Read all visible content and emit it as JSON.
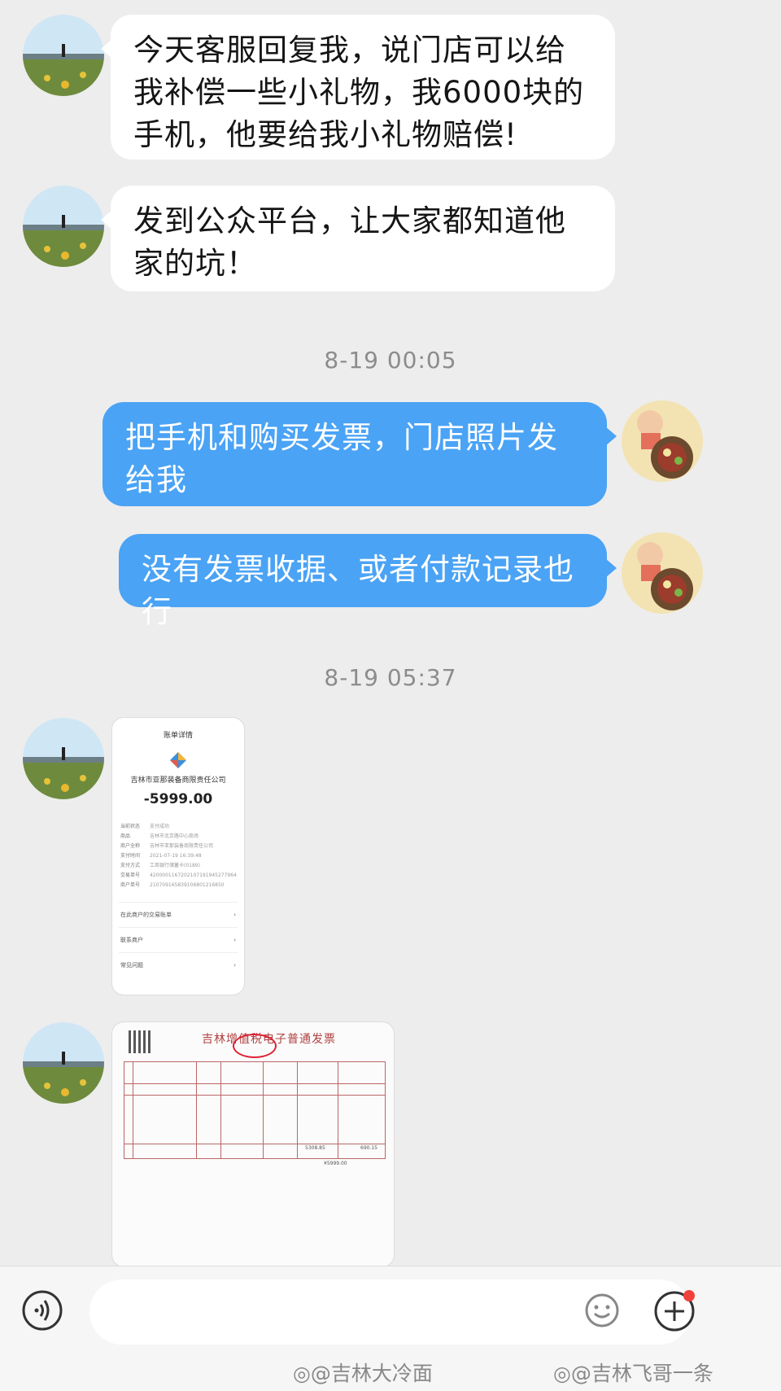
{
  "messages": [
    {
      "side": "in",
      "text": "今天客服回复我，说门店可以给我补偿一些小礼物，我6000块的手机，他要给我小礼物赔偿!"
    },
    {
      "side": "in",
      "text": "发到公众平台，让大家都知道他家的坑！"
    },
    {
      "side": "out",
      "text": "把手机和购买发票，门店照片发给我"
    },
    {
      "side": "out",
      "text": "没有发票收据、或者付款记录也行"
    }
  ],
  "timestamps": [
    "8-19 00:05",
    "8-19 05:37"
  ],
  "receipt": {
    "header": "账单详情",
    "merchant": "吉林市亚那装备商限责任公司",
    "amount": "-5999.00",
    "rows": [
      {
        "k": "当前状态",
        "v": "支付成功"
      },
      {
        "k": "商品",
        "v": "吉林市北京路中心商场"
      },
      {
        "k": "商户全称",
        "v": "吉林市亚那装备商限责任公司"
      },
      {
        "k": "支付时间",
        "v": "2021-07-19 16:39:48"
      },
      {
        "k": "支付方式",
        "v": "工商银行储蓄卡(0189)"
      },
      {
        "k": "交易单号",
        "v": "4200001167202107191945277964"
      },
      {
        "k": "商户单号",
        "v": "210709165839106801216850"
      }
    ],
    "links": [
      "在此商户的交易账单",
      "联系商户",
      "常见问题"
    ]
  },
  "invoice": {
    "title": "吉林增值税电子普通发票",
    "amount_a": "5308.85",
    "amount_b": "690.15",
    "total": "¥5999.00"
  },
  "input_bar": {
    "placeholder": ""
  },
  "watermarks": [
    "@吉林大冷面",
    "@吉林飞哥一条"
  ]
}
